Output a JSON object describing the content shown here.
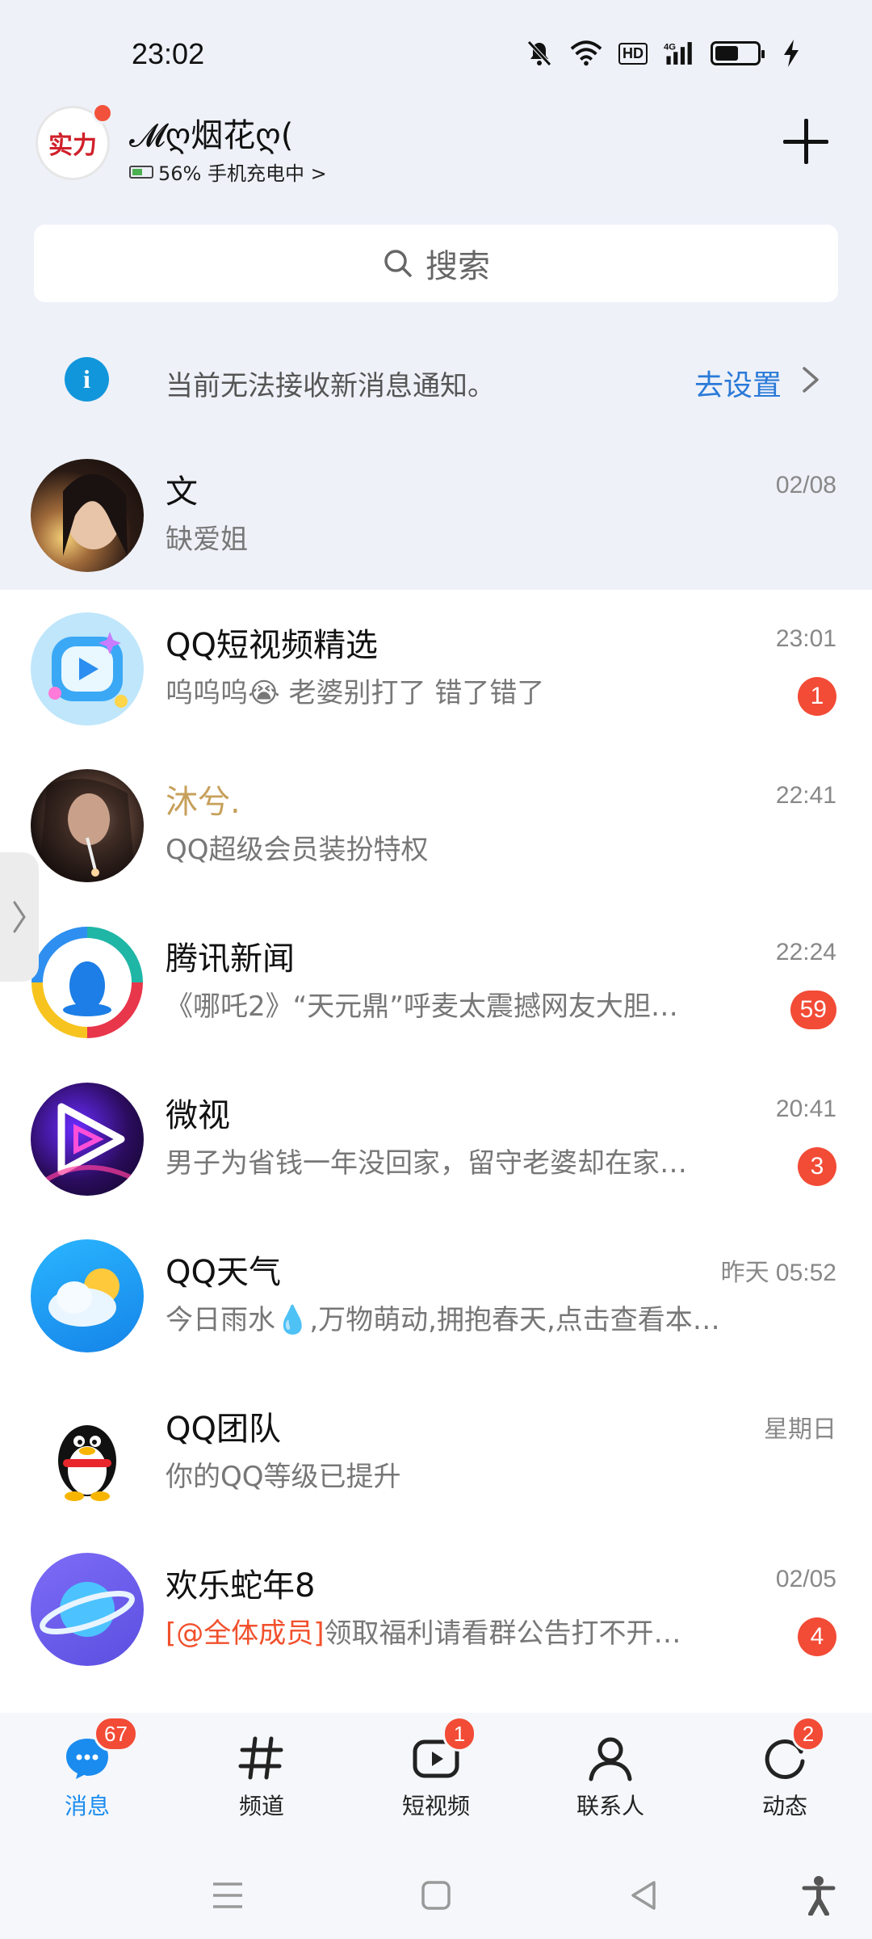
{
  "status_bar": {
    "time": "23:02",
    "hd": "HD",
    "net": "4G"
  },
  "header": {
    "avatar_text": "实力",
    "nickname": "𝓜ღ烟花ღ(",
    "battery_status": "56% 手机充电中 >"
  },
  "search": {
    "label": "搜索"
  },
  "notice": {
    "text": "当前无法接收新消息通知。",
    "link": "去设置"
  },
  "conversations": [
    {
      "name": "文",
      "message": "缺爱姐",
      "time": "02/08"
    },
    {
      "name": "QQ短视频精选",
      "message": "呜呜呜😭 老婆别打了 错了错了",
      "time": "23:01",
      "badge": "1"
    },
    {
      "name": "沐兮.",
      "message": "QQ超级会员装扮特权",
      "time": "22:41"
    },
    {
      "name": "腾讯新闻",
      "message": "《哪吒2》“天元鼎”呼麦太震撼网友大胆…",
      "time": "22:24",
      "badge": "59"
    },
    {
      "name": "微视",
      "message": "男子为省钱一年没回家，留守老婆却在家…",
      "time": "20:41",
      "badge": "3"
    },
    {
      "name": "QQ天气",
      "message": "今日雨水💧,万物萌动,拥抱春天,点击查看本地…",
      "time": "昨天 05:52"
    },
    {
      "name": "QQ团队",
      "message": "你的QQ等级已提升",
      "time": "星期日"
    },
    {
      "name": "欢乐蛇年8",
      "mention": "[@全体成员]",
      "message": "领取福利请看群公告打不开…",
      "time": "02/05",
      "badge": "4"
    }
  ],
  "bottom_nav": [
    {
      "label": "消息",
      "badge": "67",
      "icon": "chat-bubble-icon"
    },
    {
      "label": "频道",
      "icon": "hash-icon"
    },
    {
      "label": "短视频",
      "badge": "1",
      "icon": "video-icon"
    },
    {
      "label": "联系人",
      "icon": "person-icon"
    },
    {
      "label": "动态",
      "badge": "2",
      "icon": "refresh-icon"
    }
  ],
  "colors": {
    "accent": "#1a8cf0",
    "badge": "#f24b36",
    "link": "#2a7ad8",
    "vip_name": "#c6a05a",
    "top_bg": "#eef1f8"
  }
}
